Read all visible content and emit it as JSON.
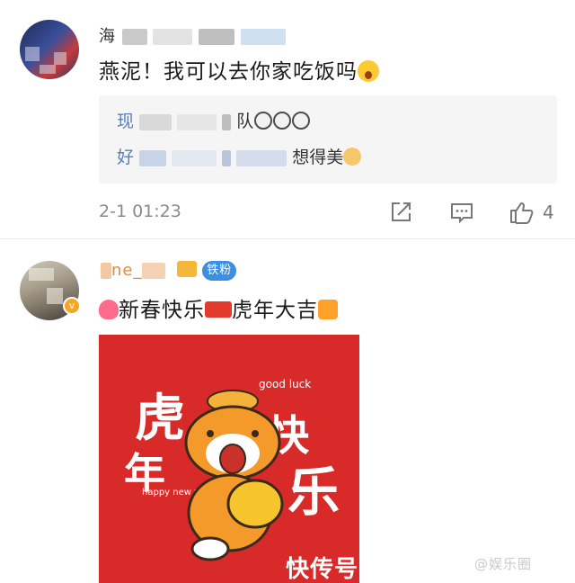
{
  "comments": [
    {
      "username_visible": "海",
      "text": "燕泥！我可以去你家吃饭吗",
      "text_emoji": "wow-face-icon",
      "replies": [
        {
          "name_visible": "现",
          "tail": "队",
          "emojis": [
            "husky-dog-icon",
            "husky-dog-icon",
            "husky-dog-icon"
          ]
        },
        {
          "name_visible": "好",
          "tail": "想得美",
          "emojis": [
            "doge-icon"
          ]
        }
      ],
      "timestamp": "2-1 01:23",
      "like_count": "4"
    },
    {
      "username_visible": "ne_",
      "fan_badge": "铁粉",
      "text_part1": "新春快乐",
      "text_part2": "虎年大吉",
      "poster": {
        "char_hu": "虎",
        "char_nian": "年",
        "char_kuai": "快",
        "char_le": "乐",
        "good_luck": "good luck",
        "happy_new_year": "happy new year"
      }
    }
  ],
  "watermark": {
    "left": "快传号",
    "right": "@娱乐圈"
  },
  "colors": {
    "reply_name": "#5b7fb4",
    "fan_badge": "#3e8fe0",
    "poster_red": "#d92a2a",
    "tiger_orange": "#f39a2b"
  }
}
